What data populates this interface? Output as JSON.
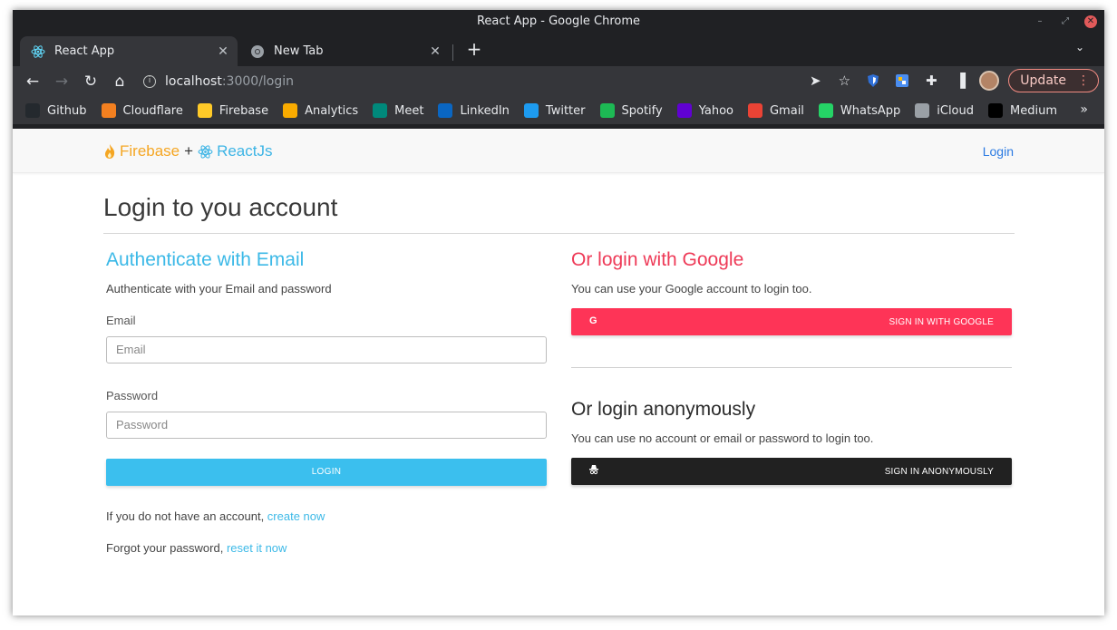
{
  "window": {
    "title": "React App - Google Chrome"
  },
  "tabs": [
    {
      "label": "React App",
      "icon": "react-icon",
      "active": true
    },
    {
      "label": "New Tab",
      "icon": "chrome-icon",
      "active": false
    }
  ],
  "toolbar": {
    "url_host": "localhost",
    "url_path": ":3000/login",
    "update_label": "Update"
  },
  "bookmarks": [
    {
      "label": "Github",
      "icon": "github-icon",
      "color": "#24292e"
    },
    {
      "label": "Cloudflare",
      "icon": "cloudflare-icon",
      "color": "#f38020"
    },
    {
      "label": "Firebase",
      "icon": "firebase-icon",
      "color": "#ffca28"
    },
    {
      "label": "Analytics",
      "icon": "analytics-icon",
      "color": "#f9ab00"
    },
    {
      "label": "Meet",
      "icon": "meet-icon",
      "color": "#00897b"
    },
    {
      "label": "LinkedIn",
      "icon": "linkedin-icon",
      "color": "#0a66c2"
    },
    {
      "label": "Twitter",
      "icon": "twitter-icon",
      "color": "#1d9bf0"
    },
    {
      "label": "Spotify",
      "icon": "spotify-icon",
      "color": "#1db954"
    },
    {
      "label": "Yahoo",
      "icon": "yahoo-icon",
      "color": "#6001d2"
    },
    {
      "label": "Gmail",
      "icon": "gmail-icon",
      "color": "#ea4335"
    },
    {
      "label": "WhatsApp",
      "icon": "whatsapp-icon",
      "color": "#25d366"
    },
    {
      "label": "iCloud",
      "icon": "apple-icon",
      "color": "#9aa0a6"
    },
    {
      "label": "Medium",
      "icon": "medium-icon",
      "color": "#000000"
    }
  ],
  "navbar": {
    "brand_firebase": "Firebase",
    "brand_plus": "+",
    "brand_react": "ReactJs",
    "login_link": "Login"
  },
  "main": {
    "title": "Login to you account",
    "email_section": {
      "heading": "Authenticate with Email",
      "subtitle": "Authenticate with your Email and password",
      "email_label": "Email",
      "email_placeholder": "Email",
      "password_label": "Password",
      "password_placeholder": "Password",
      "login_button": "LOGIN",
      "create_prefix": "If you do not have an account, ",
      "create_link": "create now",
      "reset_prefix": "Forgot your password, ",
      "reset_link": "reset it now"
    },
    "google_section": {
      "heading": "Or login with Google",
      "subtitle": "You can use your Google account to login too.",
      "button_icon": "G",
      "button_label": "SIGN IN WITH GOOGLE"
    },
    "anon_section": {
      "heading": "Or login anonymously",
      "subtitle": "You can use no account or email or password to login too.",
      "button_label": "SIGN IN ANONYMOUSLY"
    }
  },
  "colors": {
    "email_accent": "#3cb9e7",
    "google_accent": "#fe3457",
    "anon_button": "#212121",
    "firebase_brand": "#f5a623"
  }
}
